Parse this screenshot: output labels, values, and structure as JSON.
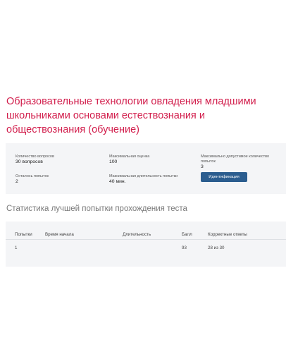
{
  "test": {
    "title": "Образовательные технологии овладения младшими школьниками основами естествознания и обществознания (обучение)"
  },
  "info": {
    "question_count_label": "Количество вопросов",
    "question_count_value": "30 вопросов",
    "max_score_label": "Максимальная оценка",
    "max_score_value": "100",
    "max_attempts_label": "Максимально допустимое количество попыток",
    "max_attempts_value": "3",
    "attempts_left_label": "Осталось попыток",
    "attempts_left_value": "2",
    "max_duration_label": "Максимальная длительность попытки",
    "max_duration_value": "40 мин.",
    "identification_button": "Идентификация"
  },
  "stats": {
    "heading": "Статистика лучшей попытки прохождения теста",
    "columns": [
      "Попытки",
      "Время начала",
      "Длительность",
      "Балл",
      "Корректные ответы"
    ],
    "rows": [
      [
        "1",
        "",
        "",
        "93",
        "28 из 30"
      ]
    ]
  },
  "colors": {
    "title": "#d21e4c",
    "button": "#2b5d8f",
    "panel_background": "#f4f5f7",
    "heading": "#7a7a7a"
  }
}
